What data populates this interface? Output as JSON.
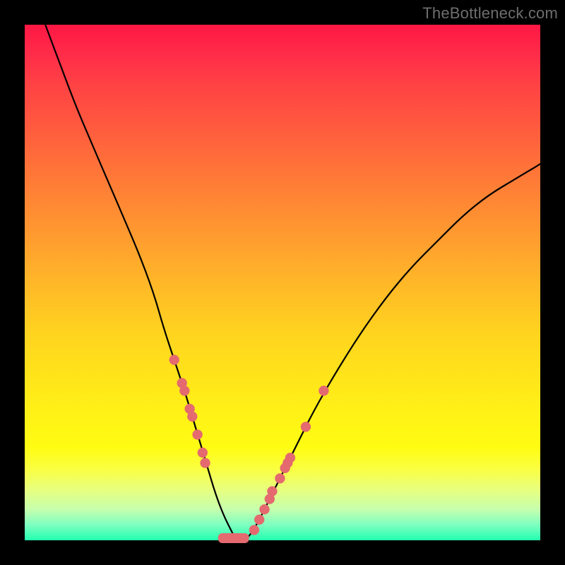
{
  "watermark": "TheBottleneck.com",
  "colors": {
    "background": "#000000",
    "gradient_top": "#ff1744",
    "gradient_mid": "#ffd41f",
    "gradient_bottom": "#22ffb0",
    "curve": "#000000",
    "dots": "#e46a6f"
  },
  "chart_data": {
    "type": "line",
    "title": "",
    "xlabel": "",
    "ylabel": "",
    "xlim": [
      0,
      100
    ],
    "ylim": [
      0,
      100
    ],
    "grid": false,
    "legend": false,
    "series": [
      {
        "name": "bottleneck-curve",
        "x": [
          4,
          7,
          10,
          13,
          16,
          19,
          22,
          25,
          27,
          29,
          31,
          32.5,
          34,
          35.5,
          37,
          38.5,
          40,
          41,
          43,
          45,
          47,
          50,
          53,
          56,
          60,
          65,
          70,
          75,
          80,
          85,
          90,
          95,
          100
        ],
        "y": [
          100,
          92,
          84,
          77,
          70,
          63,
          56,
          48,
          41,
          35,
          29,
          24,
          19,
          14,
          9,
          5,
          2,
          0,
          0,
          3,
          7,
          13,
          19,
          25,
          32,
          40,
          47,
          53,
          58,
          63,
          67,
          70,
          73
        ]
      }
    ],
    "highlight_points_left": [
      {
        "x": 29.0,
        "y": 35.0
      },
      {
        "x": 30.5,
        "y": 30.5
      },
      {
        "x": 31.0,
        "y": 29.0
      },
      {
        "x": 32.0,
        "y": 25.5
      },
      {
        "x": 32.5,
        "y": 24.0
      },
      {
        "x": 33.5,
        "y": 20.5
      },
      {
        "x": 34.5,
        "y": 17.0
      },
      {
        "x": 35.0,
        "y": 15.0
      }
    ],
    "highlight_points_right": [
      {
        "x": 44.5,
        "y": 2.0
      },
      {
        "x": 45.5,
        "y": 4.0
      },
      {
        "x": 46.5,
        "y": 6.0
      },
      {
        "x": 47.5,
        "y": 8.0
      },
      {
        "x": 48.0,
        "y": 9.5
      },
      {
        "x": 49.5,
        "y": 12.0
      },
      {
        "x": 50.5,
        "y": 14.0
      },
      {
        "x": 51.0,
        "y": 15.0
      },
      {
        "x": 51.5,
        "y": 16.0
      },
      {
        "x": 54.5,
        "y": 22.0
      },
      {
        "x": 58.0,
        "y": 29.0
      }
    ],
    "flat_bottom_range_x": [
      37.5,
      43.5
    ]
  }
}
